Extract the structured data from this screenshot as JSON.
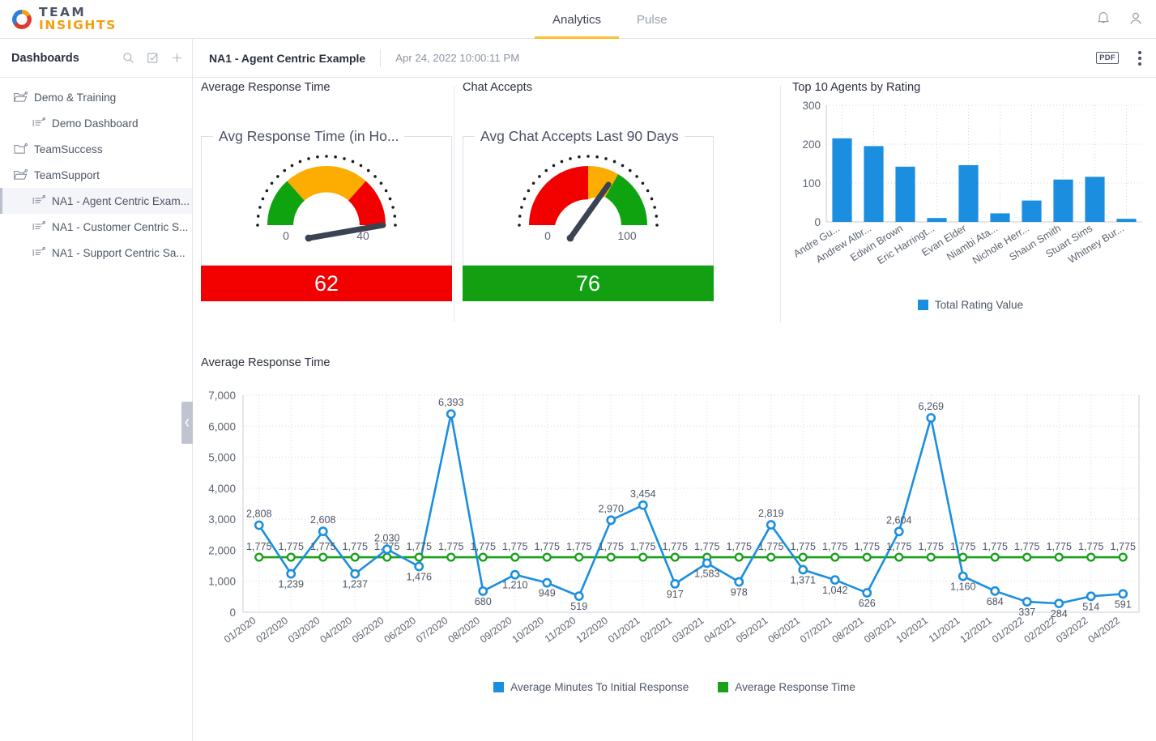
{
  "brand": {
    "team": "TEAM",
    "insights": "INSIGHTS",
    "logo_icon": "circular-arrows-icon"
  },
  "topnav": {
    "tabs": [
      {
        "label": "Analytics",
        "active": true
      },
      {
        "label": "Pulse",
        "active": false
      }
    ],
    "icons": [
      {
        "name": "notification-bell-icon"
      },
      {
        "name": "user-account-icon"
      }
    ],
    "active_accent": "#fbc02d"
  },
  "sidebar": {
    "title": "Dashboards",
    "header_icons": [
      {
        "name": "search-icon"
      },
      {
        "name": "checkbox-check-icon"
      },
      {
        "name": "plus-icon"
      }
    ],
    "items": [
      {
        "label": "Demo & Training",
        "icon": "folder-open-icon",
        "level": 0,
        "selected": false
      },
      {
        "label": "Demo Dashboard",
        "icon": "dashboard-icon",
        "level": 1,
        "selected": false
      },
      {
        "label": "TeamSuccess",
        "icon": "folder-closed-icon",
        "level": 0,
        "selected": false
      },
      {
        "label": "TeamSupport",
        "icon": "folder-open-icon",
        "level": 0,
        "selected": false
      },
      {
        "label": "NA1 - Agent Centric Exam...",
        "icon": "dashboard-icon",
        "level": 1,
        "selected": true
      },
      {
        "label": "NA1 - Customer Centric S...",
        "icon": "dashboard-icon",
        "level": 1,
        "selected": false
      },
      {
        "label": "NA1 - Support Centric Sa...",
        "icon": "dashboard-icon",
        "level": 1,
        "selected": false
      }
    ],
    "collapse_handle": "collapse-sidebar-chevron-left-icon"
  },
  "dashbar": {
    "name": "NA1 - Agent Centric Example",
    "timestamp": "Apr 24, 2022 10:00:11 PM",
    "pdf_label": "PDF",
    "menu_icon": "kebab-menu-icon"
  },
  "widgets": {
    "avg_response_time_title": "Average Response Time",
    "chat_accepts_title": "Chat Accepts",
    "top10_title": "Top 10 Agents by Rating",
    "line_chart_title": "Average Response Time"
  },
  "chart_data": [
    {
      "type": "gauge",
      "title": "Avg Response Time (in Ho...",
      "value": 62,
      "min": 0,
      "max": 100,
      "min_label": "0",
      "max_label": "40",
      "banner_value": "62",
      "banner_color": "#f20000",
      "bands": [
        {
          "from": 0,
          "to": 33,
          "color": "#10a310"
        },
        {
          "from": 33,
          "to": 67,
          "color": "#fdac02"
        },
        {
          "from": 67,
          "to": 100,
          "color": "#f20000"
        }
      ]
    },
    {
      "type": "gauge",
      "title": "Avg Chat Accepts Last 90 Days",
      "value": 76,
      "min": 0,
      "max": 100,
      "min_label": "0",
      "max_label": "100",
      "banner_value": "76",
      "banner_color": "#12a012",
      "bands": [
        {
          "from": 0,
          "to": 50,
          "color": "#f20000"
        },
        {
          "from": 50,
          "to": 68,
          "color": "#fdac02"
        },
        {
          "from": 68,
          "to": 100,
          "color": "#10a310"
        }
      ]
    },
    {
      "type": "bar",
      "title": "Top 10 Agents by Rating",
      "categories": [
        "Andre Gu...",
        "Andrew Albr...",
        "Edwin Brown",
        "Eric Harringt...",
        "Evan Elder",
        "Niambi Ata...",
        "Nichole Herr...",
        "Shaun Smith",
        "Stuart Sims",
        "Whitney Bur..."
      ],
      "values": [
        215,
        195,
        142,
        10,
        146,
        22,
        55,
        109,
        116,
        8
      ],
      "ylim": [
        0,
        300
      ],
      "yticks": [
        0,
        100,
        200,
        300
      ],
      "ylabel": "",
      "xlabel": "",
      "grid": true,
      "legend": [
        {
          "name": "Total Rating Value",
          "color": "#1f8fe0"
        }
      ],
      "legend_position": "bottom",
      "bar_color": "#1b8ee0"
    },
    {
      "type": "line",
      "title": "Average Response Time",
      "categories": [
        "01/2020",
        "02/2020",
        "03/2020",
        "04/2020",
        "05/2020",
        "06/2020",
        "07/2020",
        "08/2020",
        "09/2020",
        "10/2020",
        "11/2020",
        "12/2020",
        "01/2021",
        "02/2021",
        "03/2021",
        "04/2021",
        "05/2021",
        "06/2021",
        "07/2021",
        "08/2021",
        "09/2021",
        "10/2021",
        "11/2021",
        "12/2021",
        "01/2022",
        "02/2022",
        "03/2022",
        "04/2022"
      ],
      "ylim": [
        0,
        7000
      ],
      "yticks": [
        0,
        1000,
        2000,
        3000,
        4000,
        5000,
        6000,
        7000
      ],
      "ytick_labels": [
        "0",
        "1,000",
        "2,000",
        "3,000",
        "4,000",
        "5,000",
        "6,000",
        "7,000"
      ],
      "grid": true,
      "legend_position": "bottom",
      "series": [
        {
          "name": "Average Minutes To Initial Response",
          "color": "#1b8ee0",
          "values": [
            2808,
            1239,
            2608,
            1237,
            2030,
            1476,
            6393,
            680,
            1210,
            949,
            519,
            2970,
            3454,
            917,
            1583,
            978,
            2819,
            1371,
            1042,
            626,
            2604,
            6269,
            1160,
            684,
            337,
            284,
            514,
            591
          ],
          "labels": [
            "2,808",
            "1,239",
            "2,608",
            "1,237",
            "2,030",
            "1,476",
            "6,393",
            "680",
            "1,210",
            "949",
            "519",
            "2,970",
            "3,454",
            "917",
            "1,583",
            "978",
            "2,819",
            "1,371",
            "1,042",
            "626",
            "2,604",
            "6,269",
            "1,160",
            "684",
            "337",
            "284",
            "514",
            "591"
          ]
        },
        {
          "name": "Average Response Time",
          "color": "#1aa01a",
          "values": [
            1775,
            1775,
            1775,
            1775,
            1775,
            1775,
            1775,
            1775,
            1775,
            1775,
            1775,
            1775,
            1775,
            1775,
            1775,
            1775,
            1775,
            1775,
            1775,
            1775,
            1775,
            1775,
            1775,
            1775,
            1775,
            1775,
            1775,
            1775
          ],
          "labels": [
            "1,775",
            "1,775",
            "1,775",
            "1,775",
            "1,775",
            "1,775",
            "1,775",
            "1,775",
            "1,775",
            "1,775",
            "1,775",
            "1,775",
            "1,775",
            "1,775",
            "1,775",
            "1,775",
            "1,775",
            "1,775",
            "1,775",
            "1,775",
            "1,775",
            "1,775",
            "1,775",
            "1,775",
            "1,775",
            "1,775",
            "1,775",
            "1,775"
          ]
        }
      ]
    }
  ]
}
